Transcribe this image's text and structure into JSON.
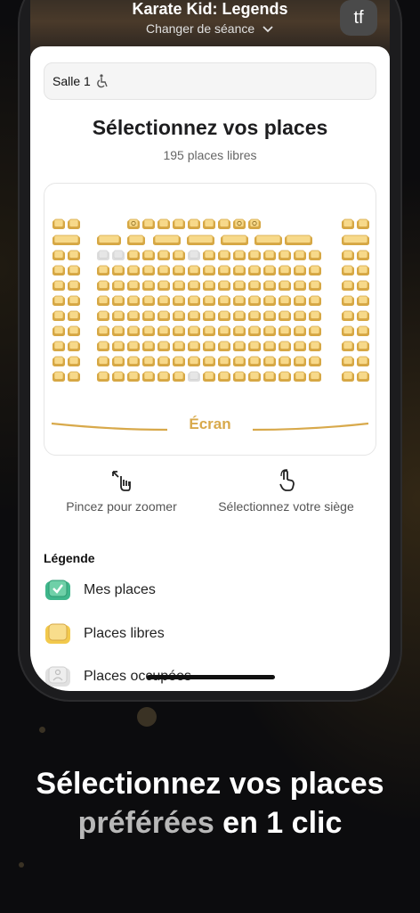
{
  "header": {
    "movie_title": "Karate Kid: Legends",
    "change_session": "Changer de séance",
    "badge": "tf"
  },
  "salle": {
    "label": "Salle 1"
  },
  "selection": {
    "title": "Sélectionnez vos places",
    "free_count": "195 places libres"
  },
  "seatmap": {
    "screen_label": "Écran"
  },
  "help": {
    "zoom": "Pincez pour zoomer",
    "select": "Sélectionnez votre siège"
  },
  "legend": {
    "title": "Légende",
    "items": [
      {
        "label": "Mes places",
        "color": "#3fb68b"
      },
      {
        "label": "Places libres",
        "color": "#f2c94c"
      },
      {
        "label": "Places occupées",
        "color": "#e0e0e0"
      }
    ]
  },
  "marketing": {
    "line1": "Sélectionnez vos places",
    "line2_muted": "préférées",
    "line2_rest": " en 1 clic"
  },
  "colors": {
    "seat_free": "#f7d98a",
    "seat_free_border": "#d6a744",
    "seat_taken": "#e6e6e6",
    "accent": "#d8a94b"
  }
}
